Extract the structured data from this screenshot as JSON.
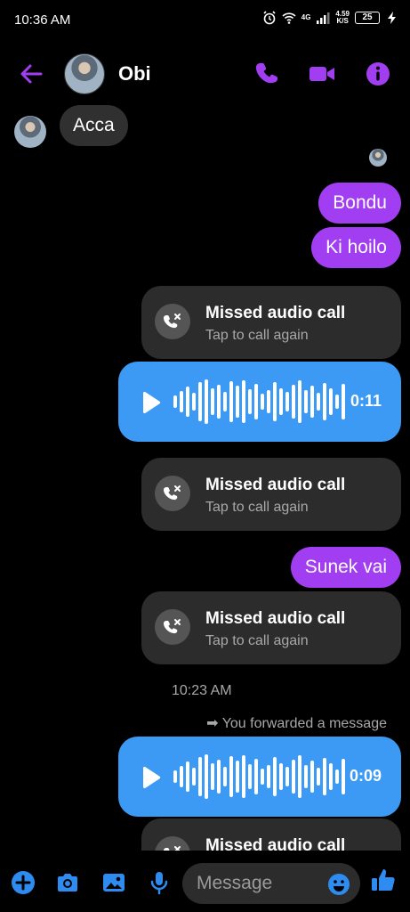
{
  "status_bar": {
    "time": "10:36 AM",
    "net_type": "4G",
    "speed_top": "4.59",
    "speed_bottom": "K/S",
    "battery": "25"
  },
  "header": {
    "contact_name": "Obi",
    "icons": [
      "back-arrow-icon",
      "phone-icon",
      "video-camera-icon",
      "info-icon"
    ],
    "accent_color": "#a23ef2"
  },
  "messages": {
    "incoming_1": "Acca",
    "outgoing_1": "Bondu",
    "outgoing_2": "Ki hoilo",
    "missed_call_title": "Missed audio call",
    "missed_call_sub": "Tap to call again",
    "voice_1_duration": "0:11",
    "outgoing_3": "Sunek vai",
    "timestamp": "10:23 AM",
    "forwarded": "➡ You forwarded a message",
    "voice_2_duration": "0:09"
  },
  "composer": {
    "placeholder": "Message",
    "icons": [
      "plus-icon",
      "camera-icon",
      "gallery-icon",
      "microphone-icon",
      "emoji-icon",
      "thumbs-up-icon"
    ]
  },
  "colors": {
    "outgoing_bubble": "#a23ef2",
    "voice_bubble": "#3c9af4",
    "incoming_bubble": "#303030",
    "icon_blue": "#2e8cf0"
  }
}
